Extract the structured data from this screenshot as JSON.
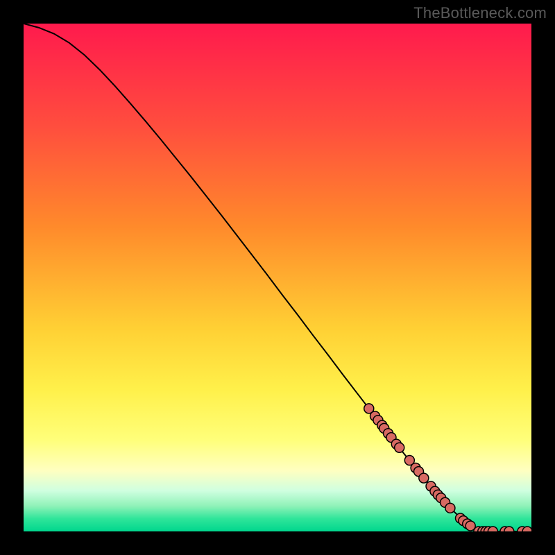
{
  "watermark": "TheBottleneck.com",
  "colors": {
    "background": "#000000",
    "curve_stroke": "#000000",
    "marker_fill": "#d86a62",
    "marker_stroke": "#000000",
    "gradient_stops": [
      {
        "offset": 0.0,
        "color": "#ff1a4d"
      },
      {
        "offset": 0.2,
        "color": "#ff4d3e"
      },
      {
        "offset": 0.4,
        "color": "#ff8a2b"
      },
      {
        "offset": 0.6,
        "color": "#ffd034"
      },
      {
        "offset": 0.72,
        "color": "#fff04a"
      },
      {
        "offset": 0.82,
        "color": "#ffff7a"
      },
      {
        "offset": 0.88,
        "color": "#ffffc0"
      },
      {
        "offset": 0.92,
        "color": "#cfffe0"
      },
      {
        "offset": 0.95,
        "color": "#8ff2b8"
      },
      {
        "offset": 0.975,
        "color": "#2fe59a"
      },
      {
        "offset": 1.0,
        "color": "#00d68d"
      }
    ]
  },
  "chart_data": {
    "type": "line",
    "title": "",
    "xlabel": "",
    "ylabel": "",
    "xlim": [
      0,
      100
    ],
    "ylim": [
      0,
      100
    ],
    "grid": false,
    "legend": false,
    "series": [
      {
        "name": "curve",
        "x": [
          0,
          3,
          6,
          9,
          12,
          15,
          18,
          21,
          24,
          27,
          30,
          33,
          36,
          39,
          42,
          45,
          48,
          51,
          54,
          57,
          60,
          63,
          66,
          69,
          72,
          75,
          78,
          81,
          84,
          87,
          90,
          93,
          96,
          99,
          100
        ],
        "y": [
          100,
          99.2,
          98.0,
          96.2,
          93.8,
          90.9,
          87.7,
          84.3,
          80.8,
          77.2,
          73.5,
          69.8,
          66.0,
          62.2,
          58.3,
          54.4,
          50.5,
          46.5,
          42.6,
          38.6,
          34.7,
          30.7,
          26.8,
          22.9,
          19.0,
          15.2,
          11.5,
          7.9,
          4.6,
          1.8,
          0.3,
          0.0,
          0.0,
          0.0,
          0.0
        ]
      }
    ],
    "markers": {
      "name": "highlighted-points",
      "points": [
        {
          "x": 68.0,
          "y": 24.2
        },
        {
          "x": 69.2,
          "y": 22.7
        },
        {
          "x": 69.8,
          "y": 21.9
        },
        {
          "x": 70.6,
          "y": 20.9
        },
        {
          "x": 71.0,
          "y": 20.3
        },
        {
          "x": 71.8,
          "y": 19.3
        },
        {
          "x": 72.4,
          "y": 18.5
        },
        {
          "x": 73.4,
          "y": 17.2
        },
        {
          "x": 74.0,
          "y": 16.5
        },
        {
          "x": 76.0,
          "y": 14.0
        },
        {
          "x": 77.2,
          "y": 12.5
        },
        {
          "x": 77.8,
          "y": 11.8
        },
        {
          "x": 78.8,
          "y": 10.5
        },
        {
          "x": 80.2,
          "y": 8.9
        },
        {
          "x": 81.0,
          "y": 7.9
        },
        {
          "x": 81.6,
          "y": 7.2
        },
        {
          "x": 82.2,
          "y": 6.6
        },
        {
          "x": 83.0,
          "y": 5.7
        },
        {
          "x": 84.0,
          "y": 4.6
        },
        {
          "x": 86.0,
          "y": 2.6
        },
        {
          "x": 86.6,
          "y": 2.1
        },
        {
          "x": 87.4,
          "y": 1.5
        },
        {
          "x": 88.0,
          "y": 1.1
        },
        {
          "x": 89.6,
          "y": 0.0
        },
        {
          "x": 90.4,
          "y": 0.0
        },
        {
          "x": 91.0,
          "y": 0.0
        },
        {
          "x": 91.6,
          "y": 0.0
        },
        {
          "x": 92.4,
          "y": 0.0
        },
        {
          "x": 94.8,
          "y": 0.0
        },
        {
          "x": 95.6,
          "y": 0.0
        },
        {
          "x": 98.2,
          "y": 0.0
        },
        {
          "x": 99.2,
          "y": 0.0
        }
      ]
    }
  }
}
